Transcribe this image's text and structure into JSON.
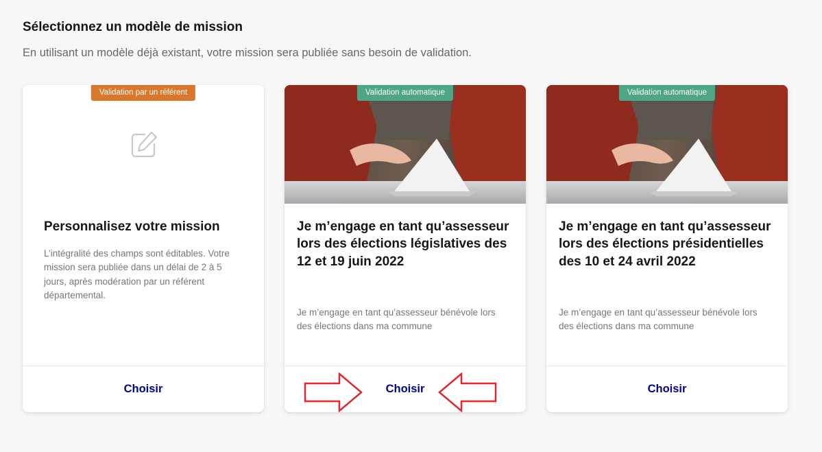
{
  "header": {
    "title": "Sélectionnez un modèle de mission",
    "subtitle": "En utilisant un modèle déjà existant, votre mission sera publiée sans besoin de validation."
  },
  "cards": [
    {
      "badge": "Validation par un référent",
      "badge_color": "#d9782d",
      "icon": "edit-icon",
      "title": "Personnalisez votre mission",
      "description": "L’intégralité des champs sont éditables. Votre mission sera publiée dans un délai de 2 à 5 jours, après modération par un référent départemental.",
      "action": "Choisir"
    },
    {
      "badge": "Validation automatique",
      "badge_color": "#4fa684",
      "image": "ballot-box-photo",
      "title": "Je m’engage en tant qu’assesseur lors des élections législatives des 12 et 19 juin 2022",
      "description": "Je m’engage en tant qu’assesseur bénévole lors des élections dans ma commune",
      "action": "Choisir"
    },
    {
      "badge": "Validation automatique",
      "badge_color": "#4fa684",
      "image": "ballot-box-photo",
      "title": "Je m’engage en tant qu’assesseur lors des élections présidentielles des 10 et 24 avril 2022",
      "description": "Je m’engage en tant qu’assesseur bénévole lors des élections dans ma commune",
      "action": "Choisir"
    }
  ],
  "annotations": {
    "arrow_color": "#e3262b",
    "arrows": [
      "right-arrow-icon",
      "left-arrow-icon"
    ]
  },
  "colors": {
    "accent": "#000091",
    "heading": "#161616",
    "muted": "#666666"
  }
}
